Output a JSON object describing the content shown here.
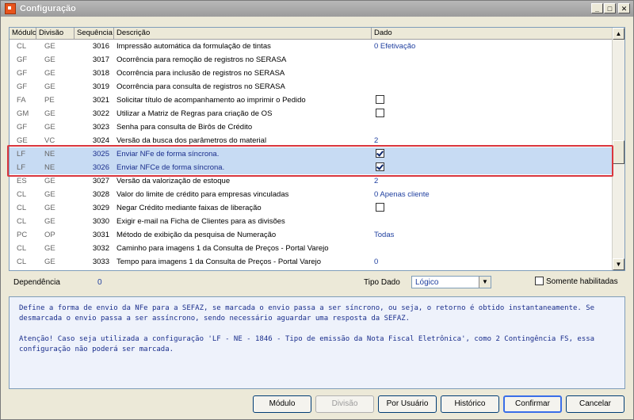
{
  "window": {
    "title": "Configuração"
  },
  "columns": {
    "modulo": "Módulo",
    "divisao": "Divisão",
    "sequencia": "Sequência",
    "descricao": "Descrição",
    "dado": "Dado"
  },
  "rows": [
    {
      "modulo": "CL",
      "divisao": "GE",
      "seq": "3016",
      "descricao": "Impressão automática da formulação de tintas",
      "dado": "0 Efetivação",
      "checkbox": null
    },
    {
      "modulo": "GF",
      "divisao": "GE",
      "seq": "3017",
      "descricao": "Ocorrência para remoção de registros no SERASA",
      "dado": "",
      "checkbox": null
    },
    {
      "modulo": "GF",
      "divisao": "GE",
      "seq": "3018",
      "descricao": "Ocorrência para inclusão de registros no SERASA",
      "dado": "",
      "checkbox": null
    },
    {
      "modulo": "GF",
      "divisao": "GE",
      "seq": "3019",
      "descricao": "Ocorrência para consulta de registros no SERASA",
      "dado": "",
      "checkbox": null
    },
    {
      "modulo": "FA",
      "divisao": "PE",
      "seq": "3021",
      "descricao": "Solicitar título de acompanhamento ao imprimir o Pedido",
      "dado": "",
      "checkbox": false
    },
    {
      "modulo": "GM",
      "divisao": "GE",
      "seq": "3022",
      "descricao": "Utilizar a Matriz de Regras para criação de OS",
      "dado": "",
      "checkbox": false
    },
    {
      "modulo": "GF",
      "divisao": "GE",
      "seq": "3023",
      "descricao": "Senha para consulta de Birôs de Crédito",
      "dado": "",
      "checkbox": null
    },
    {
      "modulo": "GE",
      "divisao": "VC",
      "seq": "3024",
      "descricao": "Versão da busca dos parâmetros do material",
      "dado": "2",
      "checkbox": null
    },
    {
      "modulo": "LF",
      "divisao": "NE",
      "seq": "3025",
      "descricao": "Enviar NFe de forma síncrona.",
      "dado": "",
      "checkbox": true,
      "selected": true
    },
    {
      "modulo": "LF",
      "divisao": "NE",
      "seq": "3026",
      "descricao": "Enviar NFCe de forma síncrona.",
      "dado": "",
      "checkbox": true,
      "selected": true
    },
    {
      "modulo": "ES",
      "divisao": "GE",
      "seq": "3027",
      "descricao": "Versão da valorização de estoque",
      "dado": "2",
      "checkbox": null
    },
    {
      "modulo": "CL",
      "divisao": "GE",
      "seq": "3028",
      "descricao": "Valor do limite de crédito para empresas vinculadas",
      "dado": "0 Apenas cliente",
      "checkbox": null
    },
    {
      "modulo": "CL",
      "divisao": "GE",
      "seq": "3029",
      "descricao": "Negar Crédito mediante faixas de liberação",
      "dado": "",
      "checkbox": false
    },
    {
      "modulo": "CL",
      "divisao": "GE",
      "seq": "3030",
      "descricao": "Exigir e-mail na Ficha de Clientes para as divisões",
      "dado": "",
      "checkbox": null
    },
    {
      "modulo": "PC",
      "divisao": "OP",
      "seq": "3031",
      "descricao": "Método de exibição da pesquisa de Numeração",
      "dado": "Todas",
      "checkbox": null
    },
    {
      "modulo": "CL",
      "divisao": "GE",
      "seq": "3032",
      "descricao": "Caminho para imagens 1 da Consulta de Preços - Portal Varejo",
      "dado": "",
      "checkbox": null
    },
    {
      "modulo": "CL",
      "divisao": "GE",
      "seq": "3033",
      "descricao": "Tempo para imagens 1 da Consulta de Preços - Portal Varejo",
      "dado": "0",
      "checkbox": null
    }
  ],
  "footer": {
    "dependencia_label": "Dependência",
    "dependencia_value": "0",
    "tipo_dado_label": "Tipo Dado",
    "tipo_dado_value": "Lógico",
    "somente_label": "Somente habilitadas"
  },
  "description": {
    "p1": "Define a forma de envio da NFe para a SEFAZ, se marcada o envio passa a ser síncrono, ou seja, o retorno é obtido instantaneamente. Se desmarcada o envio passa a ser assíncrono, sendo necessário aguardar uma resposta da SEFAZ.",
    "p2": "Atenção! Caso seja utilizada a configuração 'LF - NE - 1846 - Tipo de emissão da Nota Fiscal Eletrônica', como 2 Contingência FS, essa configuração não poderá ser marcada."
  },
  "buttons": {
    "modulo": "Módulo",
    "divisao": "Divisão",
    "por_usuario": "Por Usuário",
    "historico": "Histórico",
    "confirmar": "Confirmar",
    "cancelar": "Cancelar"
  }
}
